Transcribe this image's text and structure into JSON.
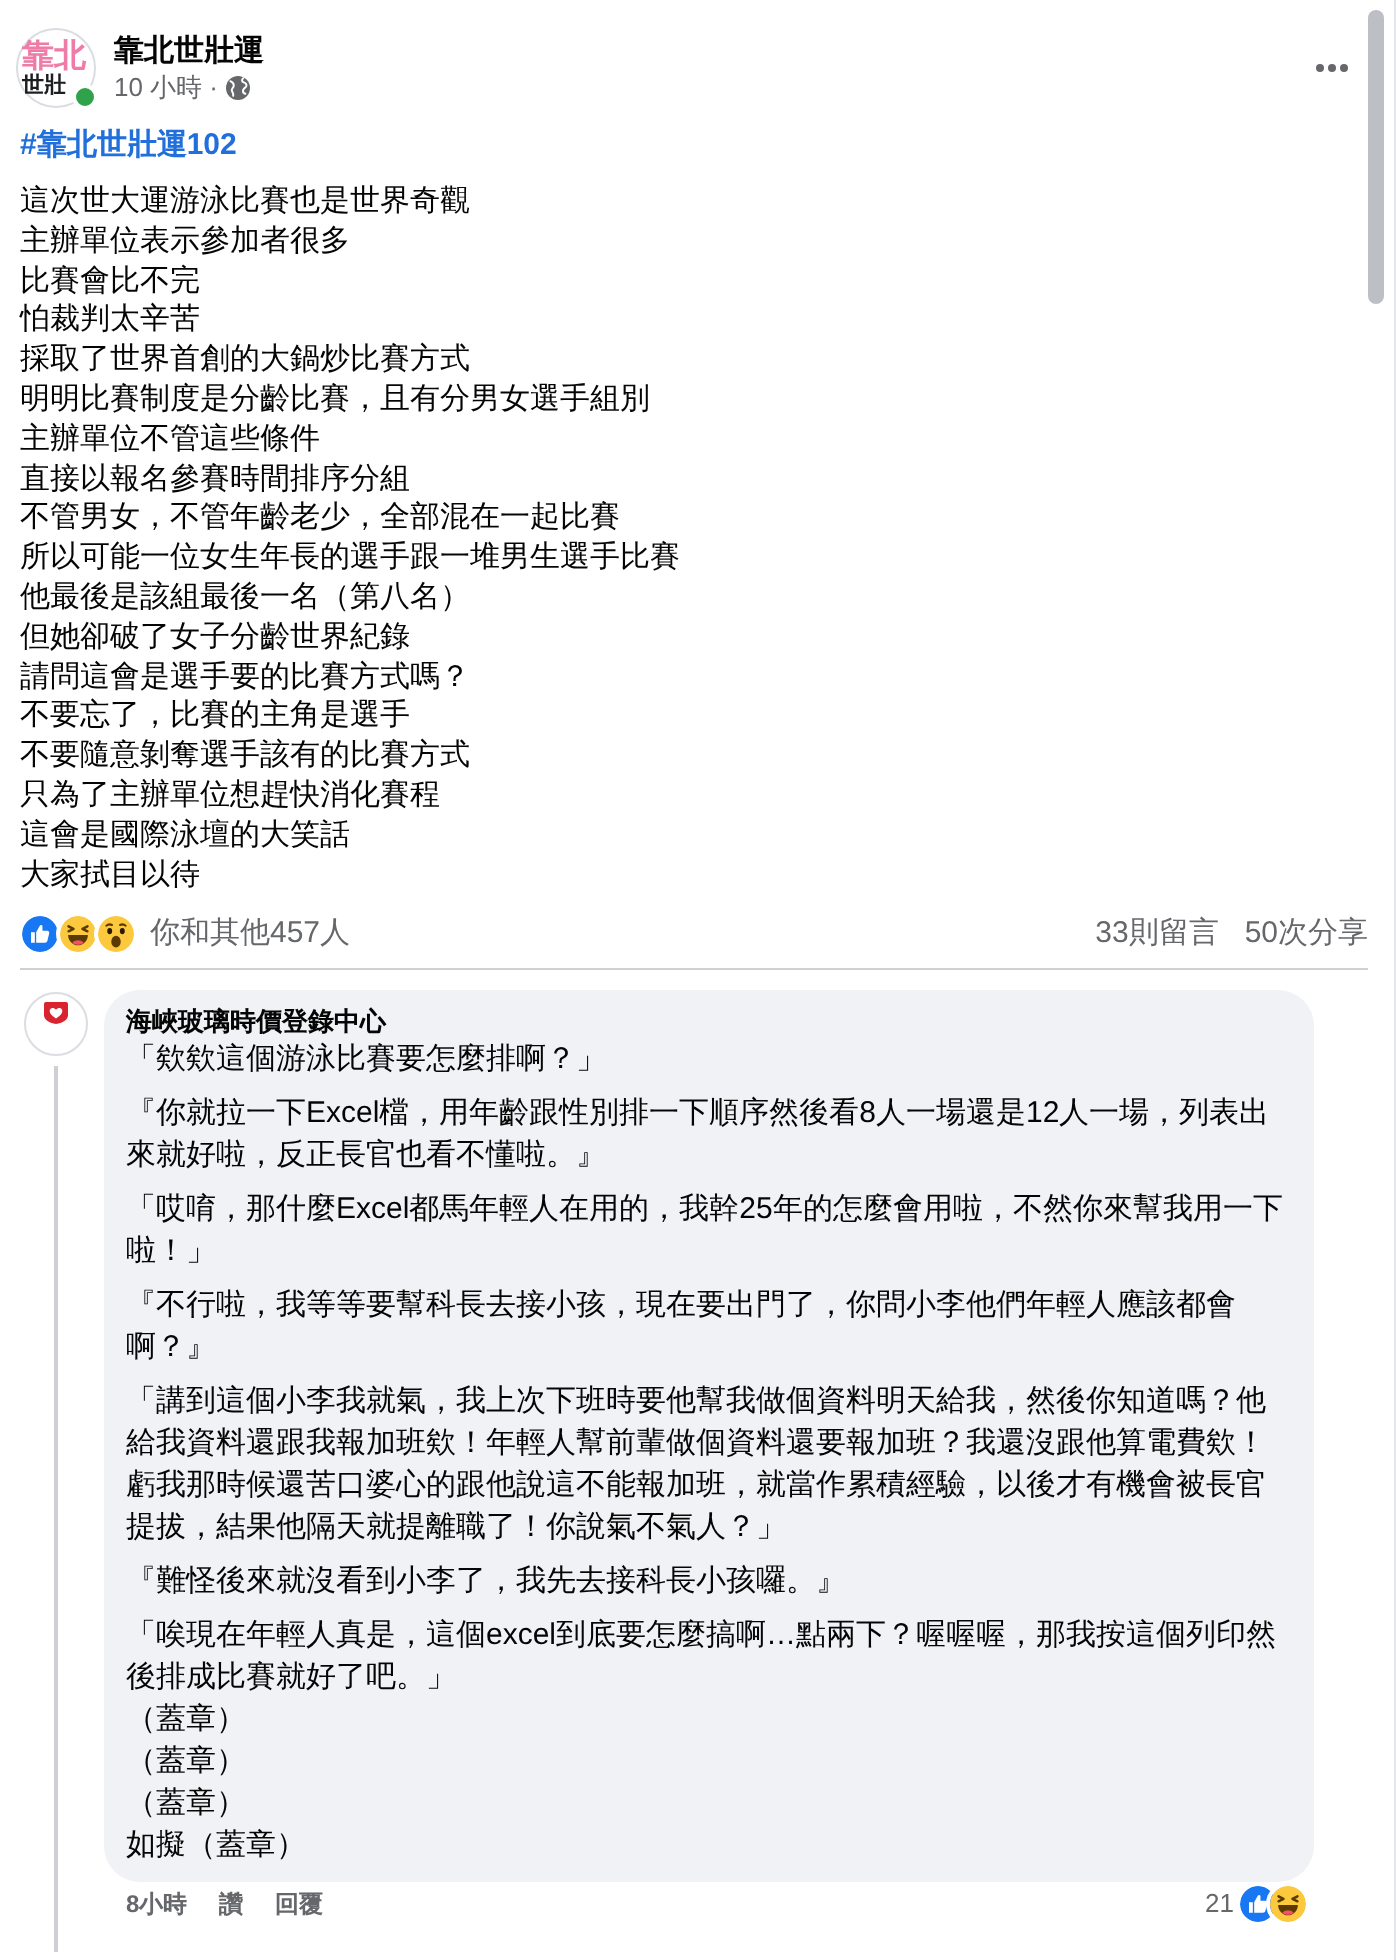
{
  "post": {
    "author": "靠北世壯運",
    "online": true,
    "avatar_lines": [
      "靠北",
      "世壯"
    ],
    "time": "10 小時 ·",
    "hashtag": "#靠北世壯運102",
    "lines": [
      "這次世大運游泳比賽也是世界奇觀",
      "主辦單位表示參加者很多",
      "比賽會比不完",
      "怕裁判太辛苦",
      "採取了世界首創的大鍋炒比賽方式",
      "明明比賽制度是分齡比賽，且有分男女選手組別",
      "主辦單位不管這些條件",
      "直接以報名參賽時間排序分組",
      "不管男女，不管年齡老少，全部混在一起比賽",
      "所以可能一位女生年長的選手跟一堆男生選手比賽",
      "他最後是該組最後一名（第八名）",
      "但她卻破了女子分齡世界紀錄",
      "請問這會是選手要的比賽方式嗎？",
      "不要忘了，比賽的主角是選手",
      "不要隨意剝奪選手該有的比賽方式",
      "只為了主辦單位想趕快消化賽程",
      "這會是國際泳壇的大笑話",
      "大家拭目以待"
    ],
    "reactions": [
      {
        "kind": "like"
      },
      {
        "kind": "haha"
      },
      {
        "kind": "wow"
      }
    ],
    "reaction_summary": "你和其他457人",
    "comments_count": "33則留言",
    "shares_count": "50次分享"
  },
  "comment": {
    "author": "海峽玻璃時價登錄中心",
    "paragraphs": [
      "「欸欸這個游泳比賽要怎麼排啊？」",
      "『你就拉一下Excel檔，用年齡跟性別排一下順序然後看8人一場還是12人一場，列表出來就好啦，反正長官也看不懂啦。』",
      "「哎唷，那什麼Excel都馬年輕人在用的，我幹25年的怎麼會用啦，不然你來幫我用一下啦！」",
      "『不行啦，我等等要幫科長去接小孩，現在要出門了，你問小李他們年輕人應該都會啊？』",
      "「講到這個小李我就氣，我上次下班時要他幫我做個資料明天給我，然後你知道嗎？他給我資料還跟我報加班欸！年輕人幫前輩做個資料還要報加班？我還沒跟他算電費欸！虧我那時候還苦口婆心的跟他說這不能報加班，就當作累積經驗，以後才有機會被長官提拔，結果他隔天就提離職了！你說氣不氣人？」",
      "『難怪後來就沒看到小李了，我先去接科長小孩囉。』",
      "「唉現在年輕人真是，這個excel到底要怎麼搞啊…點兩下？喔喔喔，那我按這個列印然後排成比賽就好了吧。」"
    ],
    "stamp_lines": [
      "（蓋章）",
      "（蓋章）",
      "（蓋章）",
      "如擬（蓋章）"
    ],
    "time": "8小時",
    "actions": [
      "讚",
      "回覆"
    ],
    "reaction_count": "21",
    "reactions": [
      {
        "kind": "like"
      },
      {
        "kind": "haha"
      }
    ]
  }
}
